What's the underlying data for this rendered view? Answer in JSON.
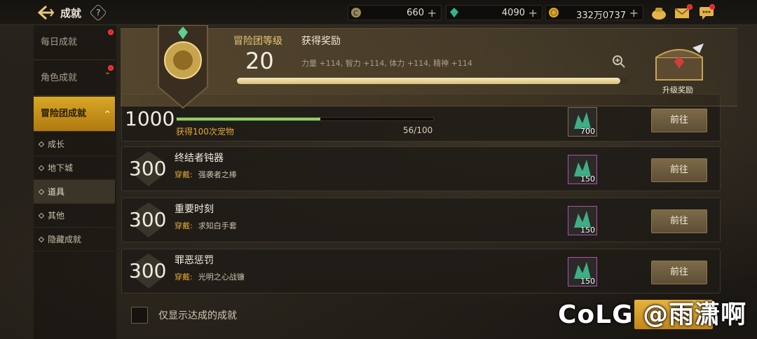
{
  "header": {
    "title": "成就",
    "help": "?"
  },
  "currencies": [
    {
      "name": "gold-coin-currency",
      "value": "660",
      "plus": "+"
    },
    {
      "name": "gem-currency",
      "value": "4090",
      "plus": "+"
    },
    {
      "name": "money-currency",
      "value": "332万0737",
      "plus": "+"
    }
  ],
  "sidebar": {
    "items": [
      {
        "label": "每日成就"
      },
      {
        "label": "角色成就"
      },
      {
        "label": "冒险团成就"
      }
    ],
    "chevron_down": "⌄",
    "chevron_up": "^",
    "subitems": [
      {
        "label": "成长"
      },
      {
        "label": "地下城"
      },
      {
        "label": "道具"
      },
      {
        "label": "其他"
      },
      {
        "label": "隐藏成就"
      }
    ]
  },
  "level_panel": {
    "level_label": "冒险团等级",
    "level_value": "20",
    "reward_title": "获得奖励",
    "reward_stats": "力量 +114, 智力 +114, 体力 +114, 精神 +114",
    "level_progress": 0.98,
    "upgrade_label": "升级奖励"
  },
  "rows": [
    {
      "points": "1000",
      "progress_label": "获得100次宠物",
      "progress_count": "56/100",
      "progress": 0.56,
      "item_count": "700",
      "button": "前往"
    },
    {
      "points": "300",
      "title": "终结者钝器",
      "sub_key": "穿戴:",
      "sub_value": "强袭者之棒",
      "item_count": "150",
      "button": "前往"
    },
    {
      "points": "300",
      "title": "重要时刻",
      "sub_key": "穿戴:",
      "sub_value": "求知白手套",
      "item_count": "150",
      "button": "前往"
    },
    {
      "points": "300",
      "title": "罪恶惩罚",
      "sub_key": "穿戴:",
      "sub_value": "光明之心战镰",
      "item_count": "150",
      "button": "前往"
    }
  ],
  "footer": {
    "checkbox_label": "仅显示达成的成就"
  },
  "watermark": "CoLG @雨潇啊"
}
